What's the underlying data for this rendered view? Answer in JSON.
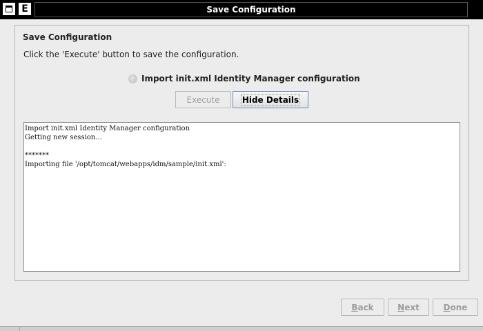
{
  "window": {
    "title": "Save Configuration",
    "menu_button_label": "",
    "app_button_label": "E"
  },
  "panel": {
    "heading": "Save Configuration",
    "instruction": "Click the 'Execute' button to save the configuration.",
    "status_label": "Import init.xml Identity Manager configuration"
  },
  "buttons": {
    "execute": "Execute",
    "hide_details": "Hide Details",
    "back_first": "B",
    "back_rest": "ack",
    "next_first": "N",
    "next_rest": "ext",
    "done_first": "D",
    "done_rest": "one"
  },
  "log": {
    "lines": [
      "Import init.xml Identity Manager configuration",
      "Getting new session...",
      "",
      "*******",
      "Importing file '/opt/tomcat/webapps/idm/sample/init.xml':"
    ]
  }
}
